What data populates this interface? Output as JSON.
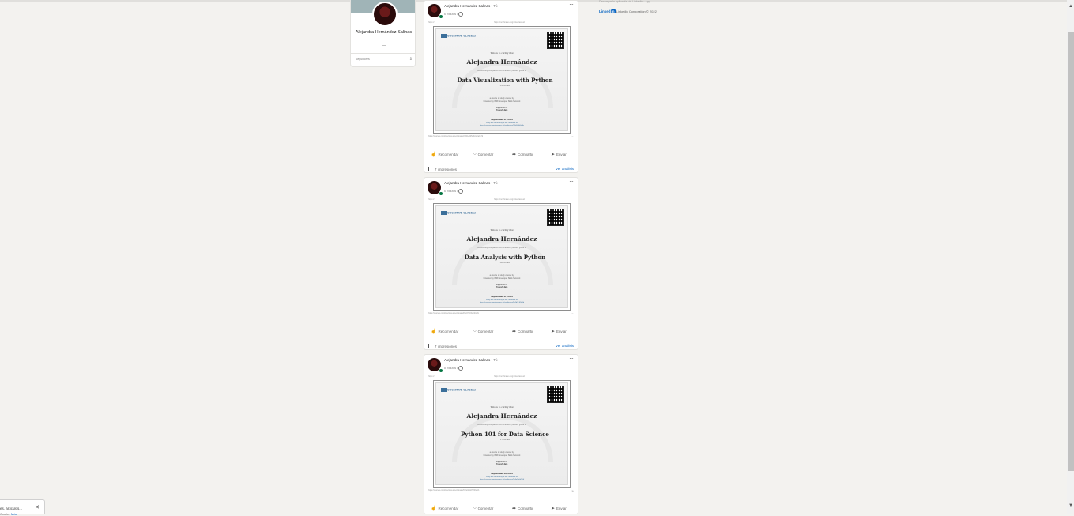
{
  "profile": {
    "name": "Alejandra Hernández Salinas",
    "dash": "—",
    "followers_label": "Seguidores"
  },
  "right_rail": {
    "app_line": "Descargar la aplicación de LinkedIn · App",
    "logo_text": "Linked",
    "logo_box": "in",
    "copyright": "LinkedIn Corporation © 2022"
  },
  "posts": [
    {
      "author": "Alejandra Hernández Salinas",
      "you": " • Tú",
      "time": "6 minutos •",
      "small_left": "https://",
      "small_center": "https://certificates.cognitiveclass.ai/",
      "url": "https://courses.cognitiveclass.ai/certificates/2f8d1e4b5a6c4c0a9e7d",
      "url_right": "≫",
      "cert": {
        "logo": "COGNITIVE CLASS.ai",
        "certify": "This is to certify that",
        "name": "Alejandra Hernández",
        "sub": "successfully completed and received a passing grade in",
        "course": "Data Visualization with Python",
        "course_code": "DV0101EN",
        "issuer_1": "a course of study offered by",
        "issuer_2": "Powered by IBM Developer Skills Network",
        "sign_role": "supported by",
        "sign_name": "Yogesh Jain",
        "date": "September 17, 2022",
        "verify_1": "Verify the authenticity of this certificate at:",
        "verify_2": "https://courses.cognitiveclass.ai/certificates/2f8d1e4b5a6c"
      },
      "actions": [
        "Recomendar",
        "Comentar",
        "Compartir",
        "Enviar"
      ],
      "impressions": "7 impresiones",
      "analytics": "Ver análisis"
    },
    {
      "author": "Alejandra Hernández Salinas",
      "you": " • Tú",
      "time": "6 minutos •",
      "small_left": "https://",
      "small_center": "https://certificates.cognitiveclass.ai/",
      "url": "https://courses.cognitiveclass.ai/certificates/8a2d7c1f9e0b4d3c",
      "url_right": "≫",
      "cert": {
        "logo": "COGNITIVE CLASS.ai",
        "certify": "This is to certify that",
        "name": "Alejandra Hernández",
        "sub": "successfully completed and received a passing grade in",
        "course": "Data Analysis with Python",
        "course_code": "DA0101EN",
        "issuer_1": "a course of study offered by",
        "issuer_2": "Powered by IBM Developer Skills Network",
        "sign_role": "supported by",
        "sign_name": "Yogesh Jain",
        "date": "September 17, 2022",
        "verify_1": "Verify the authenticity of this certificate at:",
        "verify_2": "https://courses.cognitiveclass.ai/certificates/8a2d7c1f9e0b"
      },
      "actions": [
        "Recomendar",
        "Comentar",
        "Compartir",
        "Enviar"
      ],
      "impressions": "7 impresiones",
      "analytics": "Ver análisis"
    },
    {
      "author": "Alejandra Hernández Salinas",
      "you": " • Tú",
      "time": "8 minutos •",
      "small_left": "https://",
      "small_center": "https://certificates.cognitiveclass.ai/",
      "url": "https://courses.cognitiveclass.ai/certificates/5b3e9a0d7c6f4e1b",
      "url_right": "≫",
      "cert": {
        "logo": "COGNITIVE CLASS.ai",
        "certify": "This is to certify that",
        "name": "Alejandra Hernández",
        "sub": "successfully completed and received a passing grade in",
        "course": "Python 101 for Data Science",
        "course_code": "PY0101EN",
        "issuer_1": "a course of study offered by",
        "issuer_2": "Powered by IBM Developer Skills Network",
        "sign_role": "supported by",
        "sign_name": "Yogesh Jain",
        "date": "September 16, 2022",
        "verify_1": "Verify the authenticity of this certificate at:",
        "verify_2": "https://courses.cognitiveclass.ai/certificates/5b3e9a0d7c6f"
      },
      "actions": [
        "Recomendar",
        "Comentar",
        "Compartir",
        "Enviar"
      ]
    }
  ],
  "messaging": {
    "line1": "es, artículos...",
    "line2": "Ocultar",
    "more": "Más",
    "close": "✕"
  },
  "icons": {
    "like": "like-icon",
    "comment": "comment-icon",
    "share": "share-icon",
    "send": "send-icon"
  },
  "colors": {
    "accent": "#0a66c2",
    "background": "#f3f2ef",
    "online": "#057642"
  }
}
